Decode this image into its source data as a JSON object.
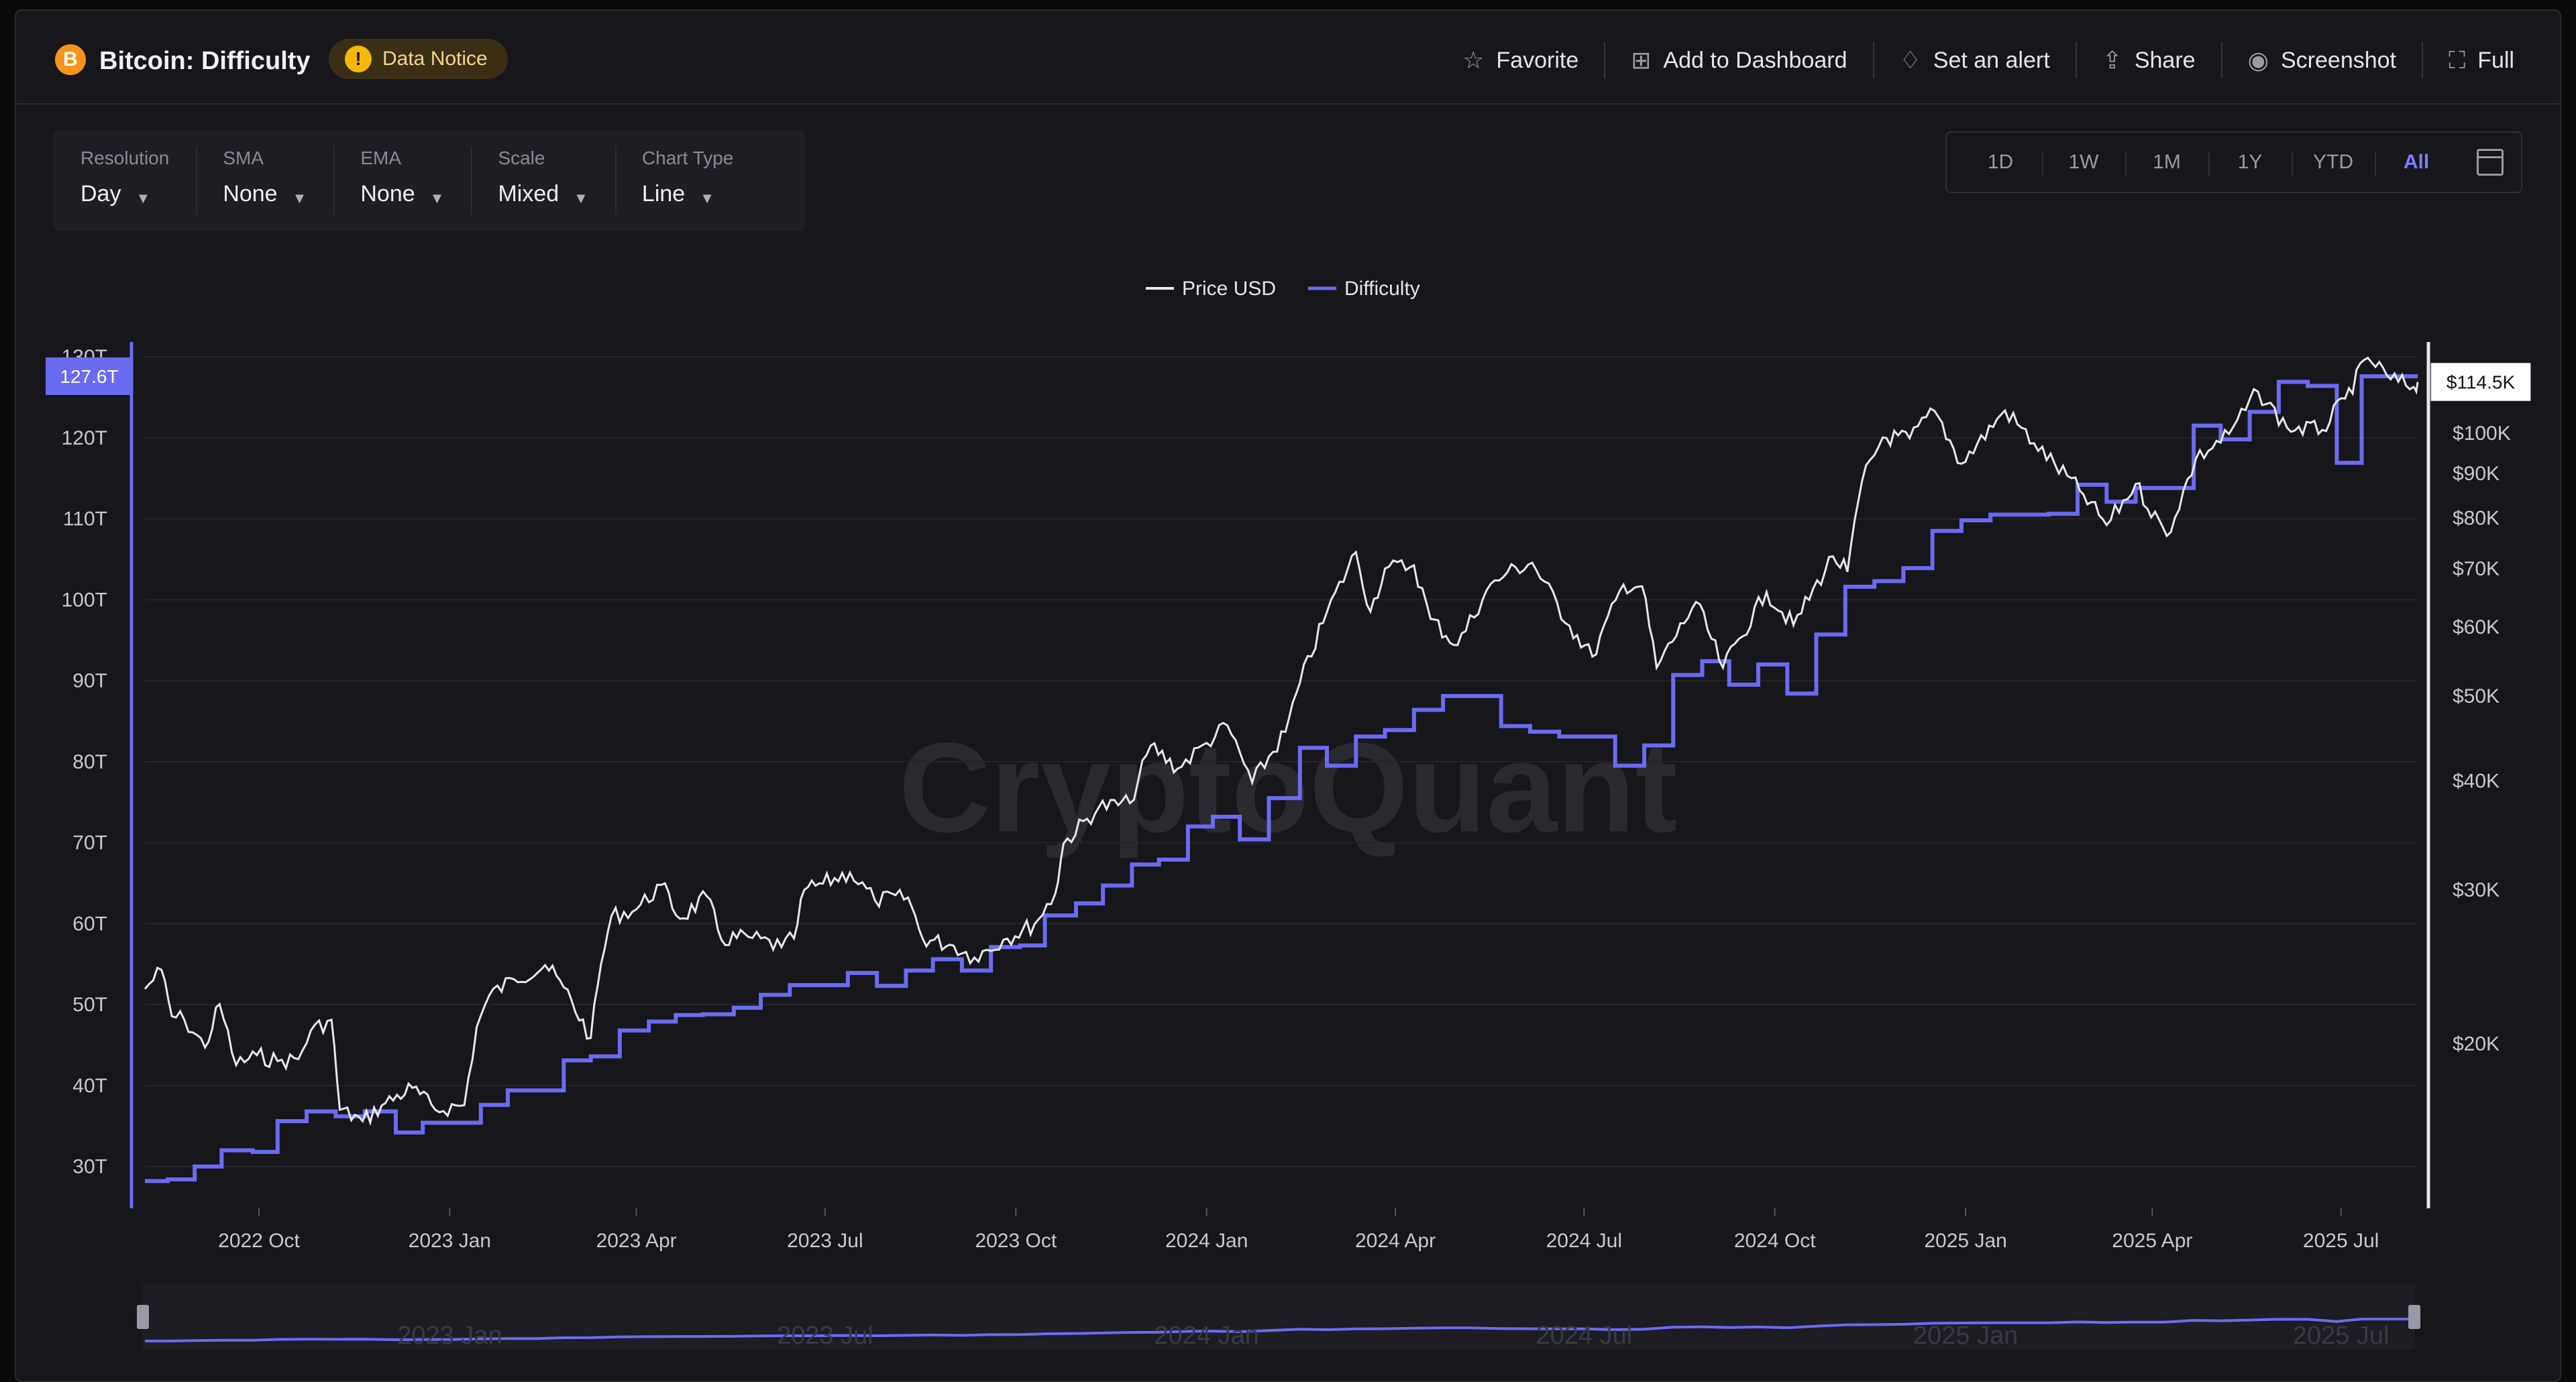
{
  "header": {
    "coin_icon": "bitcoin-icon",
    "coin_symbol": "B",
    "title": "Bitcoin: Difficulty",
    "notice_label": "Data Notice",
    "notice_symbol": "!",
    "actions": [
      {
        "label": "Favorite",
        "icon": "star-icon",
        "glyph": "☆"
      },
      {
        "label": "Add to Dashboard",
        "icon": "dashboard-add-icon",
        "glyph": "⊞"
      },
      {
        "label": "Set an alert",
        "icon": "bell-icon",
        "glyph": "♢"
      },
      {
        "label": "Share",
        "icon": "share-icon",
        "glyph": "⇪"
      },
      {
        "label": "Screenshot",
        "icon": "camera-icon",
        "glyph": "◉"
      },
      {
        "label": "Full",
        "icon": "fullscreen-icon",
        "glyph": "⛶"
      }
    ]
  },
  "controls": [
    {
      "label": "Resolution",
      "value": "Day"
    },
    {
      "label": "SMA",
      "value": "None"
    },
    {
      "label": "EMA",
      "value": "None"
    },
    {
      "label": "Scale",
      "value": "Mixed"
    },
    {
      "label": "Chart Type",
      "value": "Line"
    }
  ],
  "ranges": {
    "items": [
      "1D",
      "1W",
      "1M",
      "1Y",
      "YTD",
      "All"
    ],
    "active": "All"
  },
  "colors": {
    "difficulty": "#6b6bf2",
    "price": "#e8e8ec",
    "active_range": "#7c7cff"
  },
  "watermark": "CryptoQuant",
  "chart_data": {
    "type": "line",
    "legend": [
      "Price USD",
      "Difficulty"
    ],
    "legend_position": "top-center",
    "x_ticks": [
      "2022 Oct",
      "2023 Jan",
      "2023 Apr",
      "2023 Jul",
      "2023 Oct",
      "2024 Jan",
      "2024 Apr",
      "2024 Jul",
      "2024 Oct",
      "2025 Jan",
      "2025 Apr",
      "2025 Jul"
    ],
    "x_range": [
      "2022-08-07",
      "2025-08-07"
    ],
    "left_axis": {
      "series": "Difficulty",
      "unit": "T",
      "ticks": [
        "30T",
        "40T",
        "50T",
        "60T",
        "70T",
        "80T",
        "90T",
        "100T",
        "110T",
        "120T",
        "130T"
      ],
      "ylim": [
        25,
        131
      ],
      "scale": "linear"
    },
    "right_axis": {
      "series": "Price USD",
      "ticks": [
        "$20K",
        "$30K",
        "$40K",
        "$50K",
        "$60K",
        "$70K",
        "$80K",
        "$90K",
        "$100K"
      ],
      "scale": "log"
    },
    "last_values": {
      "difficulty": "127.6T",
      "price": "$114.5K"
    },
    "series": [
      {
        "name": "Difficulty",
        "step": true,
        "points": [
          [
            "2022-08-07",
            28.2
          ],
          [
            "2022-08-18",
            28.4
          ],
          [
            "2022-08-31",
            30.0
          ],
          [
            "2022-09-13",
            32.0
          ],
          [
            "2022-09-28",
            31.8
          ],
          [
            "2022-10-10",
            35.6
          ],
          [
            "2022-10-24",
            36.8
          ],
          [
            "2022-11-07",
            36.2
          ],
          [
            "2022-11-21",
            36.8
          ],
          [
            "2022-12-06",
            34.2
          ],
          [
            "2022-12-19",
            35.4
          ],
          [
            "2023-01-02",
            35.4
          ],
          [
            "2023-01-16",
            37.6
          ],
          [
            "2023-01-29",
            39.4
          ],
          [
            "2023-02-12",
            39.4
          ],
          [
            "2023-02-25",
            43.1
          ],
          [
            "2023-03-10",
            43.6
          ],
          [
            "2023-03-24",
            46.8
          ],
          [
            "2023-04-07",
            47.9
          ],
          [
            "2023-04-20",
            48.7
          ],
          [
            "2023-05-03",
            48.8
          ],
          [
            "2023-05-18",
            49.6
          ],
          [
            "2023-05-31",
            51.2
          ],
          [
            "2023-06-14",
            52.4
          ],
          [
            "2023-06-28",
            52.4
          ],
          [
            "2023-07-12",
            53.9
          ],
          [
            "2023-07-26",
            52.3
          ],
          [
            "2023-08-09",
            54.2
          ],
          [
            "2023-08-22",
            55.6
          ],
          [
            "2023-09-05",
            54.2
          ],
          [
            "2023-09-19",
            57.1
          ],
          [
            "2023-10-03",
            57.3
          ],
          [
            "2023-10-15",
            61.0
          ],
          [
            "2023-10-30",
            62.5
          ],
          [
            "2023-11-12",
            64.7
          ],
          [
            "2023-11-26",
            67.3
          ],
          [
            "2023-12-09",
            67.9
          ],
          [
            "2023-12-23",
            72.0
          ],
          [
            "2024-01-04",
            73.2
          ],
          [
            "2024-01-17",
            70.4
          ],
          [
            "2024-01-31",
            75.5
          ],
          [
            "2024-02-15",
            81.7
          ],
          [
            "2024-02-28",
            79.5
          ],
          [
            "2024-03-13",
            83.1
          ],
          [
            "2024-03-27",
            83.9
          ],
          [
            "2024-04-10",
            86.4
          ],
          [
            "2024-04-24",
            88.1
          ],
          [
            "2024-05-07",
            88.1
          ],
          [
            "2024-05-22",
            84.4
          ],
          [
            "2024-06-05",
            83.7
          ],
          [
            "2024-06-19",
            83.1
          ],
          [
            "2024-07-02",
            83.1
          ],
          [
            "2024-07-16",
            79.5
          ],
          [
            "2024-07-30",
            82.0
          ],
          [
            "2024-08-13",
            90.7
          ],
          [
            "2024-08-27",
            92.4
          ],
          [
            "2024-09-09",
            89.5
          ],
          [
            "2024-09-23",
            92.0
          ],
          [
            "2024-10-07",
            88.4
          ],
          [
            "2024-10-21",
            95.7
          ],
          [
            "2024-11-04",
            101.6
          ],
          [
            "2024-11-18",
            102.3
          ],
          [
            "2024-12-02",
            103.9
          ],
          [
            "2024-12-16",
            108.5
          ],
          [
            "2024-12-30",
            109.8
          ],
          [
            "2025-01-13",
            110.5
          ],
          [
            "2025-01-27",
            110.5
          ],
          [
            "2025-02-10",
            110.6
          ],
          [
            "2025-02-24",
            114.2
          ],
          [
            "2025-03-10",
            112.1
          ],
          [
            "2025-03-24",
            113.8
          ],
          [
            "2025-04-07",
            113.8
          ],
          [
            "2025-04-21",
            121.5
          ],
          [
            "2025-05-04",
            119.8
          ],
          [
            "2025-05-18",
            123.2
          ],
          [
            "2025-06-01",
            126.9
          ],
          [
            "2025-06-15",
            126.4
          ],
          [
            "2025-06-29",
            116.9
          ],
          [
            "2025-07-11",
            127.6
          ],
          [
            "2025-08-07",
            127.6
          ]
        ]
      },
      {
        "name": "Price USD",
        "step": false,
        "points": [
          [
            "2022-08-07",
            23100
          ],
          [
            "2022-08-15",
            24300
          ],
          [
            "2022-08-20",
            21500
          ],
          [
            "2022-08-26",
            21300
          ],
          [
            "2022-09-05",
            19800
          ],
          [
            "2022-09-12",
            22200
          ],
          [
            "2022-09-20",
            18900
          ],
          [
            "2022-09-30",
            19400
          ],
          [
            "2022-10-10",
            19100
          ],
          [
            "2022-10-20",
            19200
          ],
          [
            "2022-10-26",
            20700
          ],
          [
            "2022-11-05",
            21300
          ],
          [
            "2022-11-09",
            16800
          ],
          [
            "2022-11-20",
            16300
          ],
          [
            "2022-12-01",
            17100
          ],
          [
            "2022-12-14",
            17800
          ],
          [
            "2022-12-25",
            16800
          ],
          [
            "2023-01-08",
            17000
          ],
          [
            "2023-01-14",
            20900
          ],
          [
            "2023-01-20",
            22700
          ],
          [
            "2023-02-01",
            23700
          ],
          [
            "2023-02-16",
            24600
          ],
          [
            "2023-02-25",
            23200
          ],
          [
            "2023-03-10",
            20300
          ],
          [
            "2023-03-15",
            24700
          ],
          [
            "2023-03-20",
            28000
          ],
          [
            "2023-04-01",
            28500
          ],
          [
            "2023-04-13",
            30400
          ],
          [
            "2023-04-22",
            27800
          ],
          [
            "2023-05-05",
            29500
          ],
          [
            "2023-05-12",
            26300
          ],
          [
            "2023-05-25",
            26500
          ],
          [
            "2023-06-10",
            25800
          ],
          [
            "2023-06-16",
            26400
          ],
          [
            "2023-06-21",
            30000
          ],
          [
            "2023-06-30",
            30500
          ],
          [
            "2023-07-13",
            31400
          ],
          [
            "2023-07-25",
            29200
          ],
          [
            "2023-08-10",
            29400
          ],
          [
            "2023-08-17",
            26400
          ],
          [
            "2023-09-01",
            25900
          ],
          [
            "2023-09-11",
            25100
          ],
          [
            "2023-09-25",
            26300
          ],
          [
            "2023-10-10",
            27400
          ],
          [
            "2023-10-20",
            29700
          ],
          [
            "2023-10-24",
            33900
          ],
          [
            "2023-11-10",
            37300
          ],
          [
            "2023-11-25",
            37700
          ],
          [
            "2023-12-05",
            43900
          ],
          [
            "2023-12-18",
            41300
          ],
          [
            "2024-01-01",
            44200
          ],
          [
            "2024-01-11",
            46300
          ],
          [
            "2024-01-23",
            39800
          ],
          [
            "2024-02-08",
            45500
          ],
          [
            "2024-02-15",
            51800
          ],
          [
            "2024-02-28",
            62400
          ],
          [
            "2024-03-13",
            73100
          ],
          [
            "2024-03-20",
            62500
          ],
          [
            "2024-03-27",
            70000
          ],
          [
            "2024-04-10",
            70600
          ],
          [
            "2024-04-18",
            61300
          ],
          [
            "2024-05-01",
            57200
          ],
          [
            "2024-05-15",
            66100
          ],
          [
            "2024-05-25",
            69300
          ],
          [
            "2024-06-06",
            71100
          ],
          [
            "2024-06-24",
            60200
          ],
          [
            "2024-07-05",
            55500
          ],
          [
            "2024-07-20",
            67100
          ],
          [
            "2024-07-29",
            66800
          ],
          [
            "2024-08-05",
            53900
          ],
          [
            "2024-08-24",
            64100
          ],
          [
            "2024-09-06",
            53900
          ],
          [
            "2024-09-27",
            65800
          ],
          [
            "2024-10-10",
            60300
          ],
          [
            "2024-10-29",
            72300
          ],
          [
            "2024-11-05",
            69400
          ],
          [
            "2024-11-12",
            88000
          ],
          [
            "2024-11-22",
            98900
          ],
          [
            "2024-12-05",
            98700
          ],
          [
            "2024-12-17",
            106100
          ],
          [
            "2024-12-30",
            92300
          ],
          [
            "2025-01-20",
            106200
          ],
          [
            "2025-02-03",
            97400
          ],
          [
            "2025-02-25",
            86000
          ],
          [
            "2025-03-10",
            78500
          ],
          [
            "2025-03-24",
            87500
          ],
          [
            "2025-04-08",
            76300
          ],
          [
            "2025-04-22",
            93400
          ],
          [
            "2025-05-08",
            99800
          ],
          [
            "2025-05-22",
            111600
          ],
          [
            "2025-06-05",
            101500
          ],
          [
            "2025-06-22",
            100900
          ],
          [
            "2025-07-03",
            109600
          ],
          [
            "2025-07-14",
            122000
          ],
          [
            "2025-07-25",
            115300
          ],
          [
            "2025-08-05",
            113000
          ],
          [
            "2025-08-07",
            114500
          ]
        ]
      }
    ],
    "navigator": {
      "ticks": [
        "2023 Jan",
        "2023 Jul",
        "2024 Jan",
        "2024 Jul",
        "2025 Jan",
        "2025 Jul"
      ]
    }
  }
}
